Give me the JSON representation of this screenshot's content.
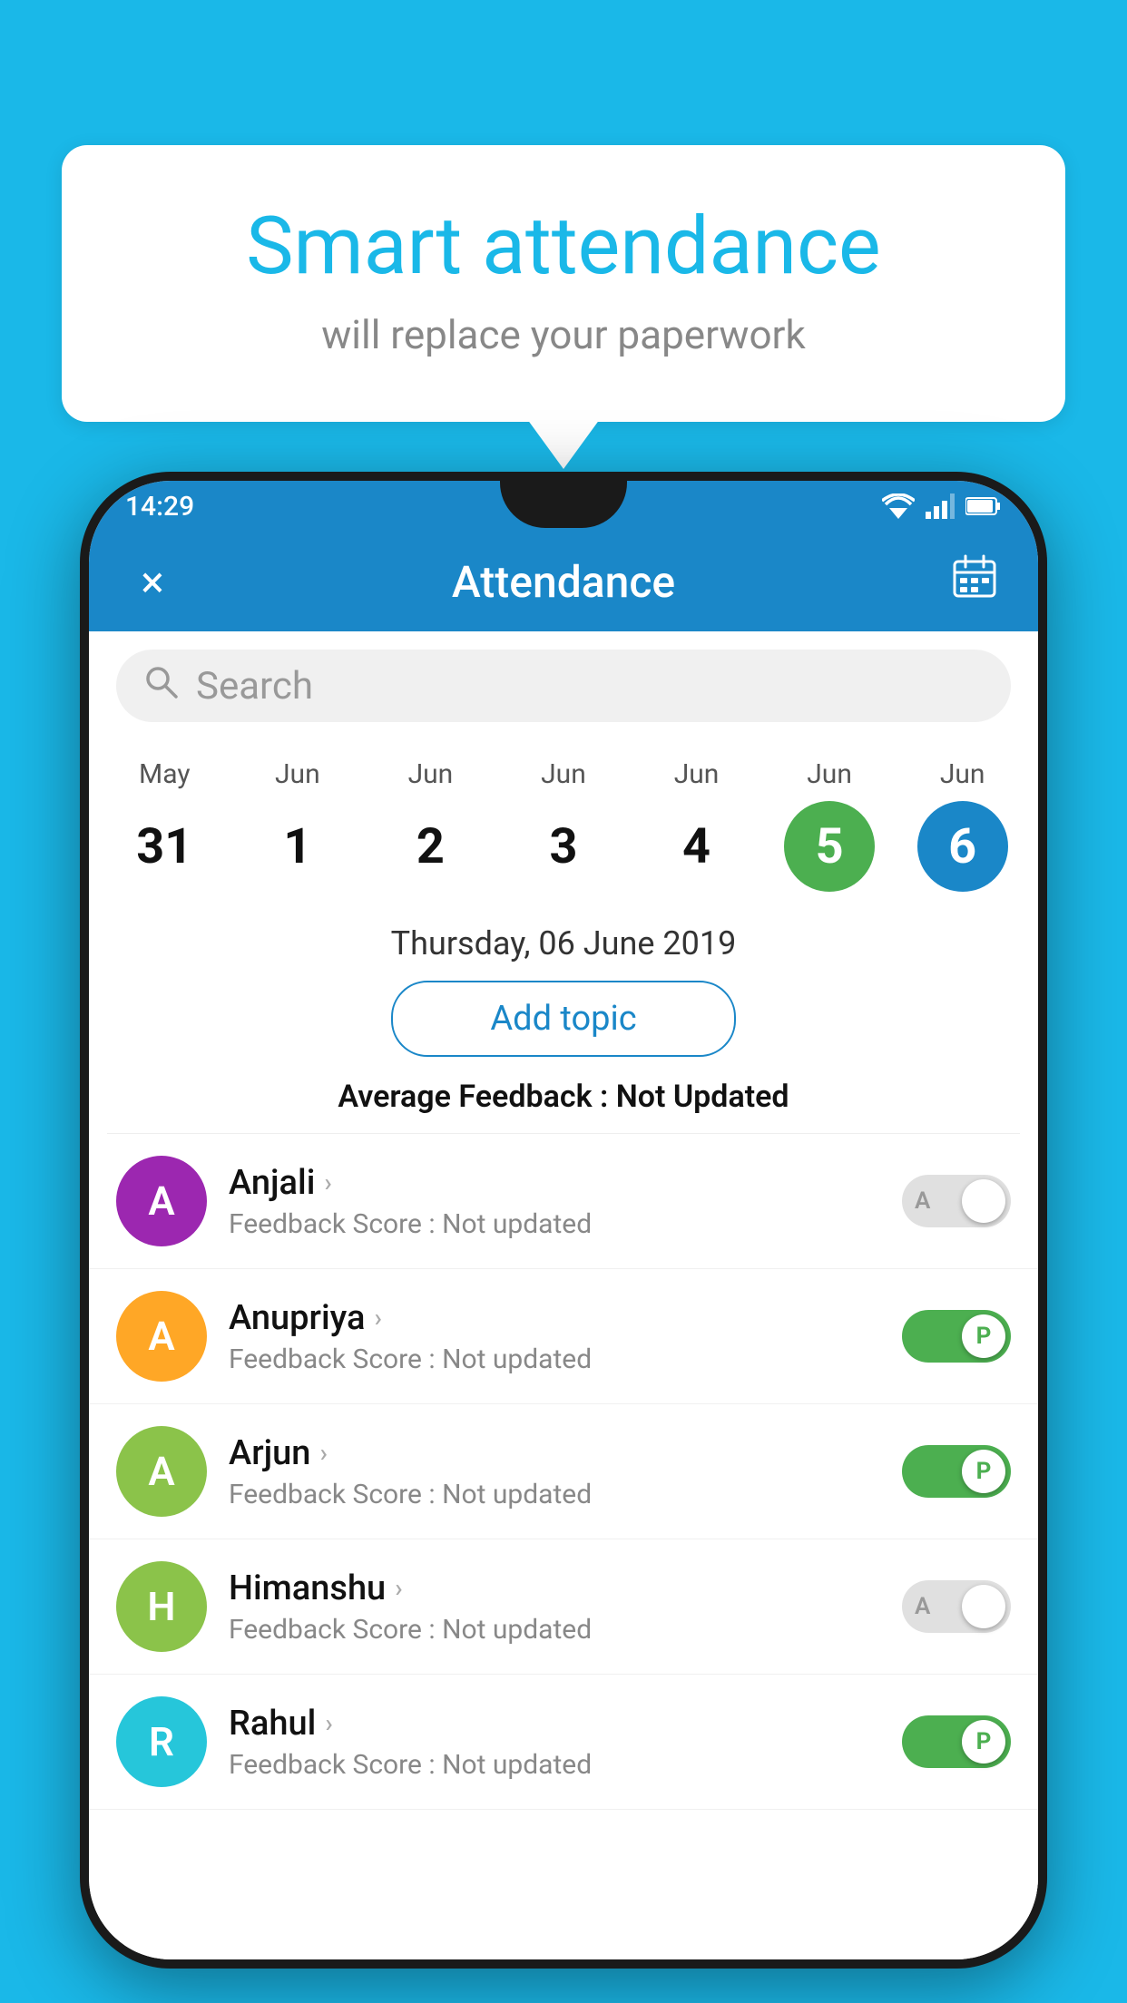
{
  "background_color": "#1ab8e8",
  "bubble": {
    "title": "Smart attendance",
    "subtitle": "will replace your paperwork"
  },
  "status_bar": {
    "time": "14:29",
    "wifi_icon": "wifi",
    "signal_icon": "signal",
    "battery_icon": "battery"
  },
  "app_bar": {
    "close_icon": "×",
    "title": "Attendance",
    "calendar_icon": "📅"
  },
  "search": {
    "placeholder": "Search"
  },
  "calendar": {
    "days": [
      {
        "month": "May",
        "date": "31",
        "style": "normal"
      },
      {
        "month": "Jun",
        "date": "1",
        "style": "normal"
      },
      {
        "month": "Jun",
        "date": "2",
        "style": "normal"
      },
      {
        "month": "Jun",
        "date": "3",
        "style": "normal"
      },
      {
        "month": "Jun",
        "date": "4",
        "style": "normal"
      },
      {
        "month": "Jun",
        "date": "5",
        "style": "today"
      },
      {
        "month": "Jun",
        "date": "6",
        "style": "selected"
      }
    ]
  },
  "selected_date": "Thursday, 06 June 2019",
  "add_topic_label": "Add topic",
  "avg_feedback_label": "Average Feedback :",
  "avg_feedback_value": "Not Updated",
  "students": [
    {
      "name": "Anjali",
      "avatar_letter": "A",
      "avatar_color": "#9C27B0",
      "feedback": "Feedback Score : Not updated",
      "attendance": "A",
      "toggle_state": "off"
    },
    {
      "name": "Anupriya",
      "avatar_letter": "A",
      "avatar_color": "#FFA726",
      "feedback": "Feedback Score : Not updated",
      "attendance": "P",
      "toggle_state": "on"
    },
    {
      "name": "Arjun",
      "avatar_letter": "A",
      "avatar_color": "#8BC34A",
      "feedback": "Feedback Score : Not updated",
      "attendance": "P",
      "toggle_state": "on"
    },
    {
      "name": "Himanshu",
      "avatar_letter": "H",
      "avatar_color": "#8BC34A",
      "feedback": "Feedback Score : Not updated",
      "attendance": "A",
      "toggle_state": "off"
    },
    {
      "name": "Rahul",
      "avatar_letter": "R",
      "avatar_color": "#26C6DA",
      "feedback": "Feedback Score : Not updated",
      "attendance": "P",
      "toggle_state": "on"
    }
  ]
}
